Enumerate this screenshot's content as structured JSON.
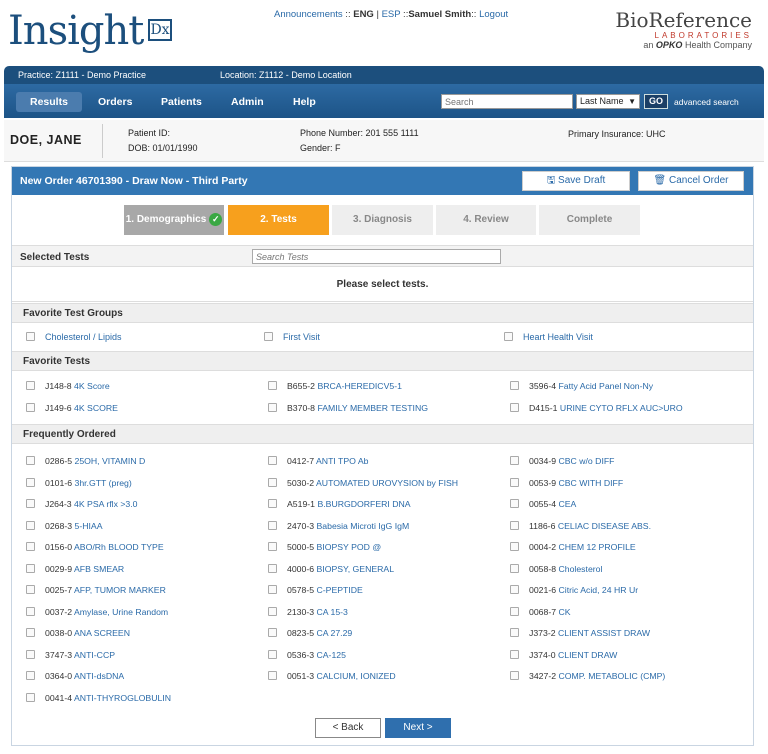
{
  "header": {
    "logo_text": "Insight",
    "logo_dx": "Dx",
    "links": {
      "announcements": "Announcements",
      "sep1": " :: ",
      "eng": "ENG",
      "sep2": " | ",
      "esp": "ESP",
      "sep3": " ::",
      "user": "Samuel Smith",
      "sep4": ":: ",
      "logout": "Logout"
    },
    "brand_name": "BioReference",
    "brand_sub": "LABORATORIES",
    "brand_tag_prefix": "an",
    "brand_tag_opko": "OPKO",
    "brand_tag_suffix": "Health Company"
  },
  "practice": {
    "practice": "Practice:  Z1111 - Demo Practice",
    "location": "Location:  Z1112 - Demo Location"
  },
  "nav": {
    "items": [
      "Results",
      "Orders",
      "Patients",
      "Admin",
      "Help"
    ],
    "search_placeholder": "Search",
    "search_by": "Last Name",
    "go": "GO",
    "advanced": "advanced search"
  },
  "patient": {
    "name": "DOE, JANE",
    "id": "Patient ID:",
    "dob": "DOB: 01/01/1990",
    "phone": "Phone Number: 201 555 1111",
    "gender": "Gender: F",
    "insurance": "Primary Insurance: UHC"
  },
  "order": {
    "title": "New Order 46701390 - Draw Now - Third Party",
    "save_draft": "Save Draft",
    "cancel_order": "Cancel Order",
    "steps": [
      "1. Demographics",
      "2. Tests",
      "3. Diagnosis",
      "4. Review",
      "Complete"
    ],
    "selected_tests": "Selected Tests",
    "search_tests_placeholder": "Search Tests",
    "please_select": "Please select tests.",
    "favorite_groups_title": "Favorite Test Groups",
    "favorite_groups": [
      "Cholesterol / Lipids",
      "First Visit",
      "Heart Health Visit"
    ],
    "favorite_tests_title": "Favorite Tests",
    "favorite_tests": [
      {
        "code": "J148-8",
        "name": "4K Score"
      },
      {
        "code": "B655-2",
        "name": "BRCA-HEREDICV5-1"
      },
      {
        "code": "3596-4",
        "name": "Fatty Acid Panel Non-Ny"
      },
      {
        "code": "J149-6",
        "name": "4K SCORE"
      },
      {
        "code": "B370-8",
        "name": "FAMILY MEMBER TESTING"
      },
      {
        "code": "D415-1",
        "name": "URINE CYTO RFLX AUC>URO"
      }
    ],
    "frequent_title": "Frequently Ordered",
    "frequent": [
      {
        "code": "0286-5",
        "name": "25OH, VITAMIN D"
      },
      {
        "code": "0412-7",
        "name": "ANTI TPO Ab"
      },
      {
        "code": "0034-9",
        "name": "CBC w/o DIFF"
      },
      {
        "code": "0101-6",
        "name": "3hr.GTT (preg)"
      },
      {
        "code": "5030-2",
        "name": "AUTOMATED UROVYSION by FISH"
      },
      {
        "code": "0053-9",
        "name": "CBC WITH DIFF"
      },
      {
        "code": "J264-3",
        "name": "4K PSA rflx >3.0"
      },
      {
        "code": "A519-1",
        "name": "B.BURGDORFERI DNA"
      },
      {
        "code": "0055-4",
        "name": "CEA"
      },
      {
        "code": "0268-3",
        "name": "5-HIAA"
      },
      {
        "code": "2470-3",
        "name": "Babesia Microti IgG IgM"
      },
      {
        "code": "1186-6",
        "name": "CELIAC DISEASE ABS."
      },
      {
        "code": "0156-0",
        "name": "ABO/Rh BLOOD TYPE"
      },
      {
        "code": "5000-5",
        "name": "BIOPSY POD @"
      },
      {
        "code": "0004-2",
        "name": "CHEM 12 PROFILE"
      },
      {
        "code": "0029-9",
        "name": "AFB SMEAR"
      },
      {
        "code": "4000-6",
        "name": "BIOPSY, GENERAL"
      },
      {
        "code": "0058-8",
        "name": "Cholesterol"
      },
      {
        "code": "0025-7",
        "name": "AFP, TUMOR MARKER"
      },
      {
        "code": "0578-5",
        "name": "C-PEPTIDE"
      },
      {
        "code": "0021-6",
        "name": "Citric Acid, 24 HR Ur"
      },
      {
        "code": "0037-2",
        "name": "Amylase, Urine Random"
      },
      {
        "code": "2130-3",
        "name": "CA 15-3"
      },
      {
        "code": "0068-7",
        "name": "CK"
      },
      {
        "code": "0038-0",
        "name": "ANA SCREEN"
      },
      {
        "code": "0823-5",
        "name": "CA 27.29"
      },
      {
        "code": "J373-2",
        "name": "CLIENT ASSIST DRAW"
      },
      {
        "code": "3747-3",
        "name": "ANTI-CCP"
      },
      {
        "code": "0536-3",
        "name": "CA-125"
      },
      {
        "code": "J374-0",
        "name": "CLIENT DRAW"
      },
      {
        "code": "0364-0",
        "name": "ANTI-dsDNA"
      },
      {
        "code": "0051-3",
        "name": "CALCIUM, IONIZED"
      },
      {
        "code": "3427-2",
        "name": "COMP. METABOLIC (CMP)"
      },
      {
        "code": "0041-4",
        "name": "ANTI-THYROGLOBULIN"
      }
    ],
    "back": "< Back",
    "next": "Next >"
  },
  "colors": {
    "nav_blue": "#1d5487",
    "header_blue": "#3377b4",
    "active_step": "#f7a01d",
    "link": "#2a6aa8"
  }
}
